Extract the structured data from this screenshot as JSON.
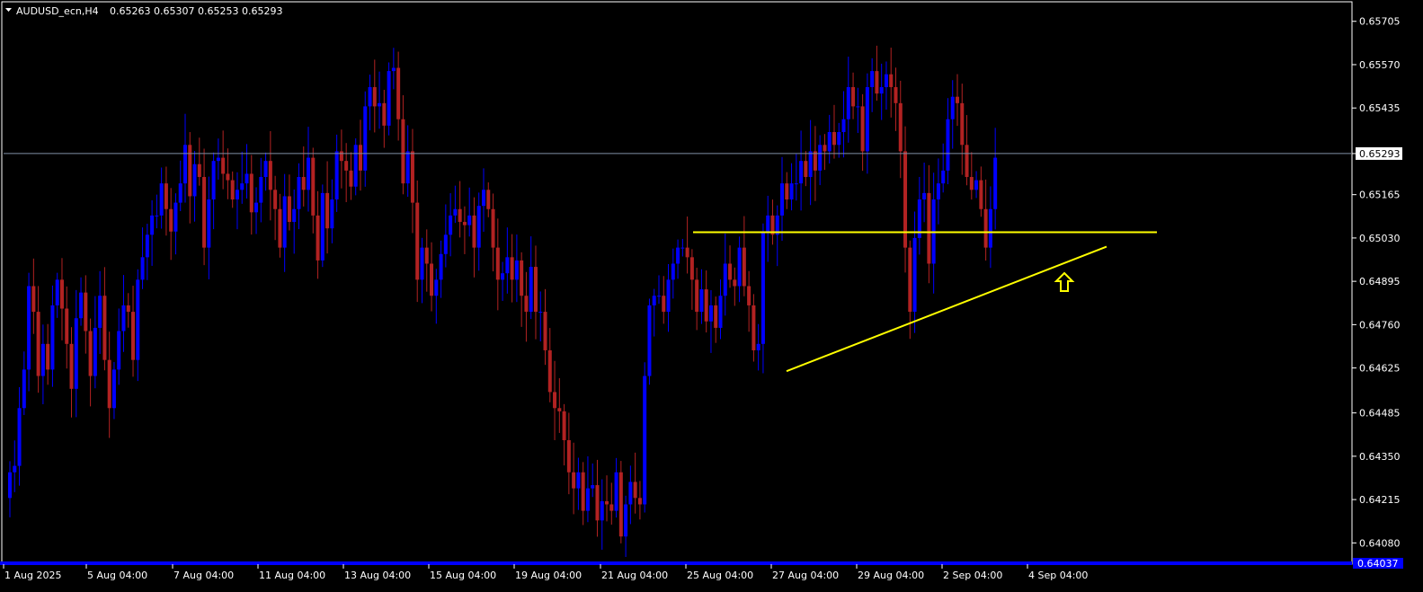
{
  "header": {
    "symbol": "AUDUSD_ecn,H4",
    "ohlc": "0.65263 0.65307 0.65253 0.65293"
  },
  "colors": {
    "background": "#000000",
    "bull": "#0000ff",
    "bear": "#b22222",
    "wick_bull": "#0000ff",
    "wick_bear": "#b22222",
    "grid_line": "#7f8fa6",
    "trend_line": "#ffff00",
    "axis": "#ffffff"
  },
  "chart_data": {
    "type": "candlestick",
    "timeframe": "H4",
    "ylim": [
      0.64025,
      0.65763
    ],
    "y_ticks": [
      "0.65705",
      "0.65570",
      "0.65435",
      "0.65293",
      "0.65165",
      "0.65030",
      "0.64895",
      "0.64760",
      "0.64625",
      "0.64485",
      "0.64350",
      "0.64215",
      "0.64080"
    ],
    "x_ticks": [
      "1 Aug 2025",
      "5 Aug 04:00",
      "7 Aug 04:00",
      "11 Aug 04:00",
      "13 Aug 04:00",
      "15 Aug 04:00",
      "19 Aug 04:00",
      "21 Aug 04:00",
      "25 Aug 04:00",
      "27 Aug 04:00",
      "29 Aug 04:00",
      "2 Sep 04:00",
      "4 Sep 04:00"
    ],
    "current_price": "0.65293",
    "bottom_price": "0.64037",
    "horizontal_level": 0.65048,
    "trendline": {
      "from": {
        "bar": 126,
        "price": 0.64615
      },
      "to": {
        "bar": 245,
        "price": 0.65003
      }
    },
    "arrow": {
      "bar": 235,
      "direction": "up"
    },
    "closes": [
      0.643,
      0.6432,
      0.645,
      0.6462,
      0.6488,
      0.648,
      0.646,
      0.647,
      0.6462,
      0.6482,
      0.649,
      0.6481,
      0.647,
      0.6456,
      0.6478,
      0.6486,
      0.6474,
      0.646,
      0.6475,
      0.6485,
      0.6465,
      0.645,
      0.6462,
      0.6474,
      0.6482,
      0.648,
      0.6465,
      0.649,
      0.6497,
      0.6504,
      0.651,
      0.651,
      0.652,
      0.6512,
      0.6505,
      0.6514,
      0.652,
      0.6532,
      0.6516,
      0.6526,
      0.6522,
      0.65,
      0.6515,
      0.6527,
      0.6528,
      0.6523,
      0.6521,
      0.6515,
      0.6518,
      0.652,
      0.6523,
      0.6511,
      0.6514,
      0.6522,
      0.6527,
      0.6518,
      0.6512,
      0.65,
      0.6516,
      0.6508,
      0.6512,
      0.6522,
      0.6518,
      0.6528,
      0.651,
      0.6496,
      0.6517,
      0.6506,
      0.6515,
      0.653,
      0.6527,
      0.6524,
      0.6519,
      0.6532,
      0.6524,
      0.6544,
      0.655,
      0.6544,
      0.6545,
      0.6538,
      0.6555,
      0.6556,
      0.654,
      0.652,
      0.653,
      0.6514,
      0.649,
      0.65,
      0.6495,
      0.6485,
      0.649,
      0.6498,
      0.6504,
      0.651,
      0.6512,
      0.6508,
      0.6507,
      0.651,
      0.65,
      0.6513,
      0.6518,
      0.6512,
      0.65,
      0.649,
      0.6492,
      0.6497,
      0.649,
      0.6496,
      0.6485,
      0.648,
      0.6494,
      0.648,
      0.648,
      0.6468,
      0.6455,
      0.645,
      0.6449,
      0.644,
      0.643,
      0.6425,
      0.643,
      0.6418,
      0.6425,
      0.6426,
      0.6415,
      0.6421,
      0.642,
      0.6418,
      0.643,
      0.641,
      0.642,
      0.6427,
      0.6422,
      0.642,
      0.646,
      0.6482,
      0.6485,
      0.6485,
      0.648,
      0.649,
      0.6495,
      0.65,
      0.65,
      0.6497,
      0.649,
      0.648,
      0.6487,
      0.6477,
      0.6482,
      0.6475,
      0.6485,
      0.6495,
      0.649,
      0.6488,
      0.65,
      0.6488,
      0.6482,
      0.6468,
      0.647,
      0.6505,
      0.651,
      0.6504,
      0.651,
      0.652,
      0.6515,
      0.652,
      0.652,
      0.6527,
      0.6522,
      0.653,
      0.6524,
      0.6532,
      0.653,
      0.6536,
      0.6532,
      0.6536,
      0.654,
      0.655,
      0.6544,
      0.6544,
      0.653,
      0.655,
      0.6555,
      0.6548,
      0.655,
      0.6554,
      0.655,
      0.6545,
      0.653,
      0.65,
      0.648,
      0.6503,
      0.6515,
      0.6517,
      0.6495,
      0.6515,
      0.652,
      0.6524,
      0.654,
      0.6547,
      0.6545,
      0.6532,
      0.6522,
      0.6518,
      0.6521,
      0.6512,
      0.65,
      0.6512,
      0.6528
    ],
    "note_closes": "Approximate H4 closes per bar, read from the price axis"
  }
}
